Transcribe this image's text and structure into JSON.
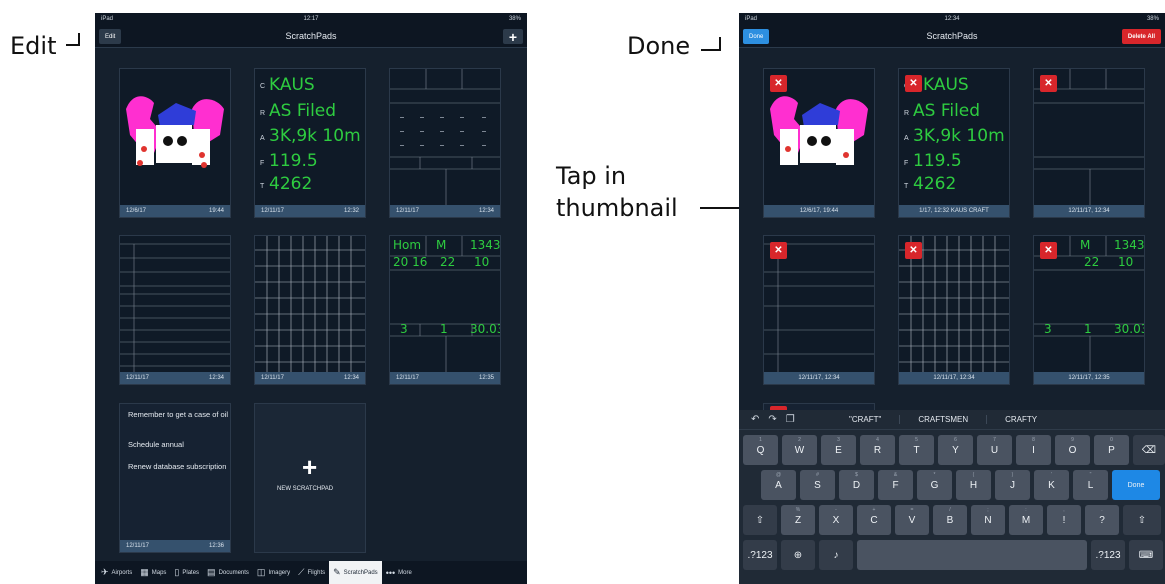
{
  "callouts": {
    "edit": "Edit",
    "done": "Done",
    "tap_line1": "Tap in",
    "tap_line2": "thumbnail"
  },
  "left_screen": {
    "status": {
      "carrier": "iPad",
      "time": "12:17",
      "battery": "38%"
    },
    "nav": {
      "edit_button": "Edit",
      "title": "ScratchPads",
      "add_icon": "plus-icon"
    },
    "thumbnails": [
      {
        "date": "12/6/17",
        "time": "19:44",
        "kind": "drawing"
      },
      {
        "date": "12/11/17",
        "time": "12:32",
        "kind": "craft",
        "letters": [
          "C",
          "R",
          "A",
          "F",
          "T"
        ],
        "ink": [
          "KAUS",
          "AS Filed",
          "3K,9k 10m",
          "119.5",
          "4262"
        ]
      },
      {
        "date": "12/11/17",
        "time": "12:34",
        "kind": "form"
      },
      {
        "date": "12/11/17",
        "time": "12:34",
        "kind": "form"
      },
      {
        "date": "12/11/17",
        "time": "12:34",
        "kind": "grid"
      },
      {
        "date": "12/11/17",
        "time": "12:35",
        "kind": "form-ink",
        "ink": [
          "Hom",
          "M",
          "1343",
          "20 16",
          "22",
          "10",
          "3",
          "1",
          "30.03"
        ]
      },
      {
        "date": "12/11/17",
        "time": "12:36",
        "kind": "note",
        "lines": [
          "Remember to get a case of oil",
          "Schedule annual",
          "Renew database subscription"
        ]
      }
    ],
    "new_scratchpad": "NEW SCRATCHPAD",
    "tabs": [
      {
        "label": "Airports",
        "icon": "airport-icon"
      },
      {
        "label": "Maps",
        "icon": "map-icon"
      },
      {
        "label": "Plates",
        "icon": "plates-icon"
      },
      {
        "label": "Documents",
        "icon": "documents-icon"
      },
      {
        "label": "Imagery",
        "icon": "imagery-icon"
      },
      {
        "label": "Flights",
        "icon": "flights-icon"
      },
      {
        "label": "ScratchPads",
        "icon": "pencil-icon"
      },
      {
        "label": "More",
        "icon": "more-icon"
      }
    ]
  },
  "right_screen": {
    "status": {
      "carrier": "iPad",
      "time": "12:34",
      "battery": "38%"
    },
    "nav": {
      "done_button": "Done",
      "title": "ScratchPads",
      "delete_all_button": "Delete All"
    },
    "thumbnails": [
      {
        "caption": "12/6/17, 19:44"
      },
      {
        "caption": "1/17, 12:32 KAUS CRAFT"
      },
      {
        "caption": "12/11/17, 12:34"
      },
      {
        "caption": "12/11/17, 12:34"
      },
      {
        "caption": "12/11/17, 12:34"
      },
      {
        "caption": "12/11/17, 12:35"
      }
    ],
    "keyboard": {
      "suggestions": [
        "\"CRAFT\"",
        "CRAFTSMEN",
        "CRAFTY"
      ],
      "row1": [
        {
          "k": "Q",
          "s": "1"
        },
        {
          "k": "W",
          "s": "2"
        },
        {
          "k": "E",
          "s": "3"
        },
        {
          "k": "R",
          "s": "4"
        },
        {
          "k": "T",
          "s": "5"
        },
        {
          "k": "Y",
          "s": "6"
        },
        {
          "k": "U",
          "s": "7"
        },
        {
          "k": "I",
          "s": "8"
        },
        {
          "k": "O",
          "s": "9"
        },
        {
          "k": "P",
          "s": "0"
        }
      ],
      "row2": [
        {
          "k": "A",
          "s": "@"
        },
        {
          "k": "S",
          "s": "#"
        },
        {
          "k": "D",
          "s": "$"
        },
        {
          "k": "F",
          "s": "&"
        },
        {
          "k": "G",
          "s": "*"
        },
        {
          "k": "H",
          "s": "("
        },
        {
          "k": "J",
          "s": ")"
        },
        {
          "k": "K",
          "s": "'"
        },
        {
          "k": "L",
          "s": "\""
        }
      ],
      "row3": [
        {
          "k": "Z",
          "s": "%"
        },
        {
          "k": "X",
          "s": "-"
        },
        {
          "k": "C",
          "s": "+"
        },
        {
          "k": "V",
          "s": "="
        },
        {
          "k": "B",
          "s": "/"
        },
        {
          "k": "N",
          "s": ";"
        },
        {
          "k": "M",
          "s": ":"
        },
        {
          "k": "!",
          "s": ","
        },
        {
          "k": "?",
          "s": "."
        }
      ],
      "done_key": "Done",
      "num_key": ".?123"
    }
  }
}
